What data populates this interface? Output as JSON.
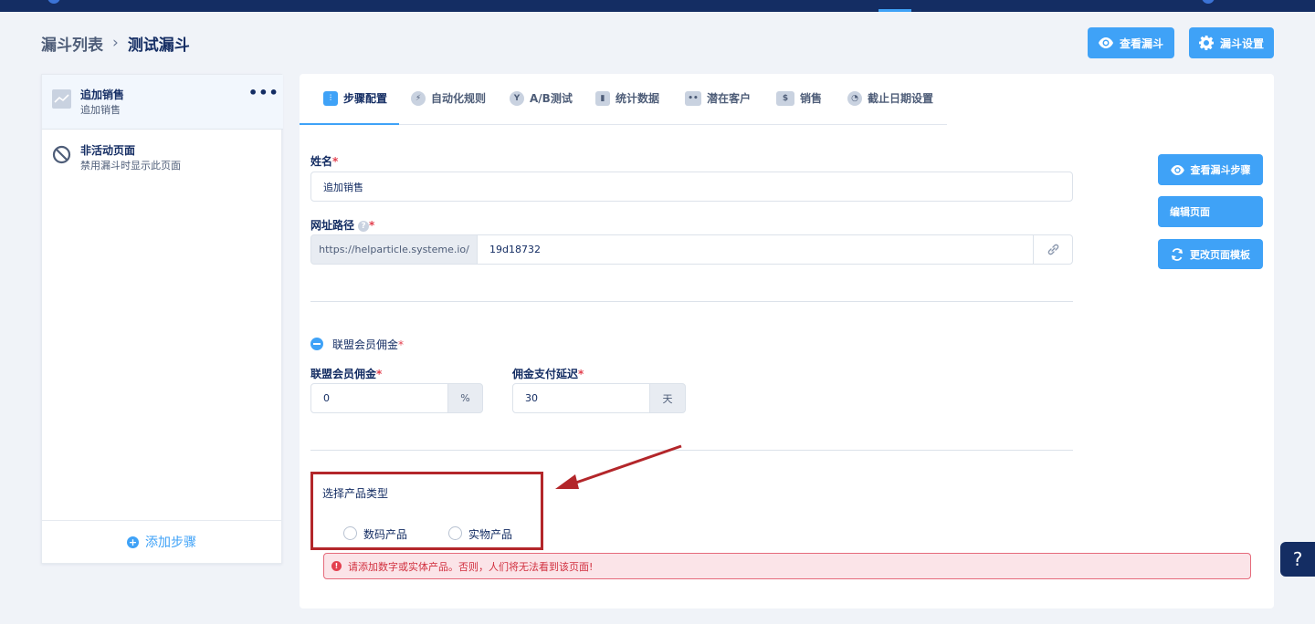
{
  "breadcrumb": {
    "parent": "漏斗列表",
    "separator": "›",
    "current": "测试漏斗"
  },
  "header_buttons": {
    "view_funnel": "查看漏斗",
    "funnel_settings": "漏斗设置"
  },
  "sidebar": {
    "steps": [
      {
        "title": "追加销售",
        "subtitle": "追加销售",
        "icon": "trend-chart-icon",
        "more": "•••"
      },
      {
        "title": "非活动页面",
        "subtitle": "禁用漏斗时显示此页面",
        "icon": "disabled-circle-icon"
      }
    ],
    "add_step": "添加步骤"
  },
  "tabs": [
    {
      "label": "步骤配置",
      "icon": "sliders-icon",
      "active": true
    },
    {
      "label": "自动化规则",
      "icon": "lightning-icon"
    },
    {
      "label": "A/B测试",
      "icon": "split-icon"
    },
    {
      "label": "统计数据",
      "icon": "bar-chart-icon"
    },
    {
      "label": "潜在客户",
      "icon": "users-icon"
    },
    {
      "label": "销售",
      "icon": "dollar-icon"
    },
    {
      "label": "截止日期设置",
      "icon": "clock-icon"
    }
  ],
  "form": {
    "name_label": "姓名",
    "name_value": "追加销售",
    "url_label": "网址路径",
    "url_prefix": "https://helparticle.systeme.io/",
    "url_value": "19d18732",
    "affiliate_section": "联盟会员佣金",
    "commission_label": "联盟会员佣金",
    "commission_value": "0",
    "commission_unit": "%",
    "delay_label": "佣金支付延迟",
    "delay_value": "30",
    "delay_unit": "天",
    "product_type_label": "选择产品类型",
    "digital_product": "数码产品",
    "physical_product": "实物产品",
    "required_mark": "*",
    "help_mark": "?"
  },
  "side_buttons": {
    "view_steps": "查看漏斗步骤",
    "edit_page": "编辑页面",
    "change_template": "更改页面模板"
  },
  "alert": {
    "text": "请添加数字或实体产品。否则，人们将无法看到该页面!",
    "icon": "!"
  },
  "help_fab": "?",
  "colors": {
    "primary": "#3fa2f7",
    "navy": "#142d63",
    "error": "#e3404f",
    "annotation": "#b3262a"
  }
}
